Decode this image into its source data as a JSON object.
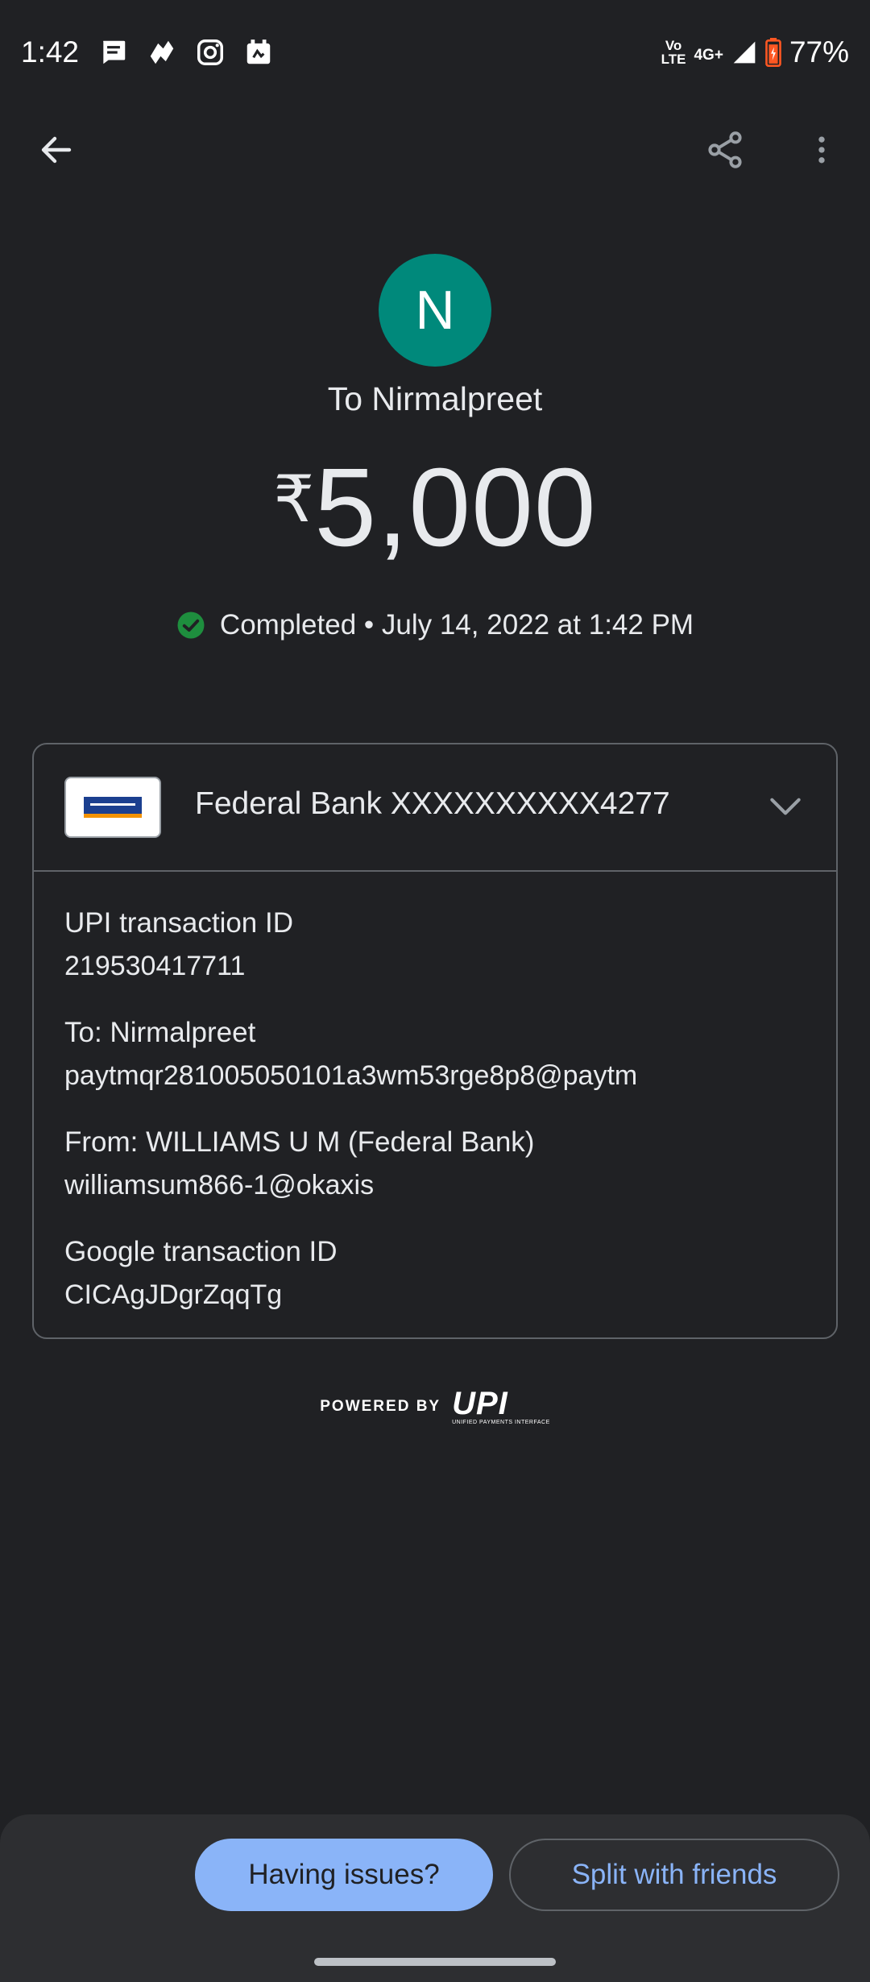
{
  "status_bar": {
    "time": "1:42",
    "volte_top": "Vo",
    "volte_bottom": "LTE",
    "network": "4G+",
    "battery": "77%",
    "notification_icons": [
      "messages-icon",
      "app-icon",
      "instagram-icon",
      "calendar-icon"
    ]
  },
  "app_bar": {
    "back_icon": "arrow-back-icon",
    "share_icon": "share-icon",
    "more_icon": "more-vert-icon"
  },
  "header": {
    "avatar_letter": "N",
    "recipient": "To Nirmalpreet",
    "currency_symbol": "₹",
    "amount": "5,000",
    "status": "Completed • July 14, 2022 at 1:42 PM"
  },
  "card": {
    "bank": "Federal Bank XXXXXXXXXX4277",
    "details": [
      {
        "label": "UPI transaction ID",
        "value": "219530417711"
      },
      {
        "label": "To: Nirmalpreet",
        "value": "paytmqr281005050101a3wm53rge8p8@paytm"
      },
      {
        "label": "From: WILLIAMS U M (Federal Bank)",
        "value": "williamsum866-1@okaxis"
      },
      {
        "label": "Google transaction ID",
        "value": "CICAgJDgrZqqTg"
      }
    ]
  },
  "footer": {
    "powered_by": "POWERED BY",
    "upi_mark": "UPI",
    "upi_sub": "UNIFIED PAYMENTS INTERFACE"
  },
  "actions": {
    "issues_label": "Having issues?",
    "split_label": "Split with friends"
  },
  "colors": {
    "background": "#202124",
    "avatar": "#00897b",
    "accent": "#8ab4f8",
    "success": "#1e8e3e"
  }
}
